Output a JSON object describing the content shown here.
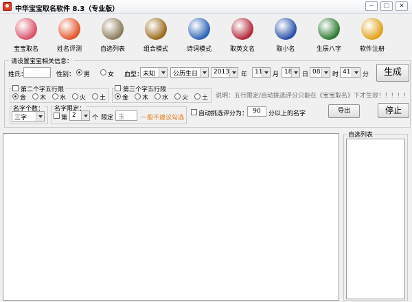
{
  "window": {
    "title": "中华宝宝取名软件 8.3（专业版）",
    "minimize": "─",
    "maximize": "□",
    "close": "✕"
  },
  "toolbar": [
    {
      "label": "宝宝取名",
      "icon": "baby-icon",
      "color": "#d9506a"
    },
    {
      "label": "姓名评测",
      "icon": "gourd-icon",
      "color": "#e3552b"
    },
    {
      "label": "自选列表",
      "icon": "brush-icon",
      "color": "#8c7b5c"
    },
    {
      "label": "组合模式",
      "icon": "lion-icon",
      "color": "#9a6a1c"
    },
    {
      "label": "诗词模式",
      "icon": "book-icon",
      "color": "#2c63b8"
    },
    {
      "label": "取英文名",
      "icon": "badge-icon",
      "color": "#b22a3a"
    },
    {
      "label": "取小名",
      "icon": "globe-icon",
      "color": "#2a4fa8"
    },
    {
      "label": "生辰八字",
      "icon": "bagua-icon",
      "color": "#2d7a32"
    },
    {
      "label": "软件注册",
      "icon": "lock-icon",
      "color": "#e0a21c"
    }
  ],
  "form": {
    "section_title": "请设置宝宝相关信息：",
    "surname_label": "姓氏：",
    "surname_value": "",
    "gender_label": "性别：",
    "gender_options": [
      "男",
      "女"
    ],
    "gender_selected": "男",
    "blood_label": "血型：",
    "blood_value": "未知",
    "calendar_value": "公历生日",
    "year_value": "2013",
    "year_unit": "年",
    "month_value": "11",
    "month_unit": "月",
    "day_value": "18",
    "day_unit": "日",
    "hour_value": "08",
    "hour_unit": "时",
    "minute_value": "41",
    "minute_unit": "分",
    "generate_label": "生成",
    "second_char_label": "第二个字五行限",
    "third_char_label": "第三个字五行限",
    "elements": [
      "金",
      "木",
      "水",
      "火",
      "土"
    ],
    "note": "说明：五行限定/自动挑选评分只能在《宝宝取名》下才生效！！！！！",
    "name_count_label": "名字个数：",
    "name_count_value": "三字",
    "name_limit_label": "名字限定：",
    "position_prefix": "第",
    "position_value": "2",
    "position_suffix": "个",
    "limit_label": "限定",
    "limit_value": "玉",
    "limit_warning": "一般不建议勾选",
    "auto_pick_label": "自动挑选评分为：",
    "score_value": "90",
    "score_suffix": "分以上的名字",
    "export_label": "导出",
    "stop_label": "停止"
  },
  "self_list": {
    "title": "自选列表"
  }
}
